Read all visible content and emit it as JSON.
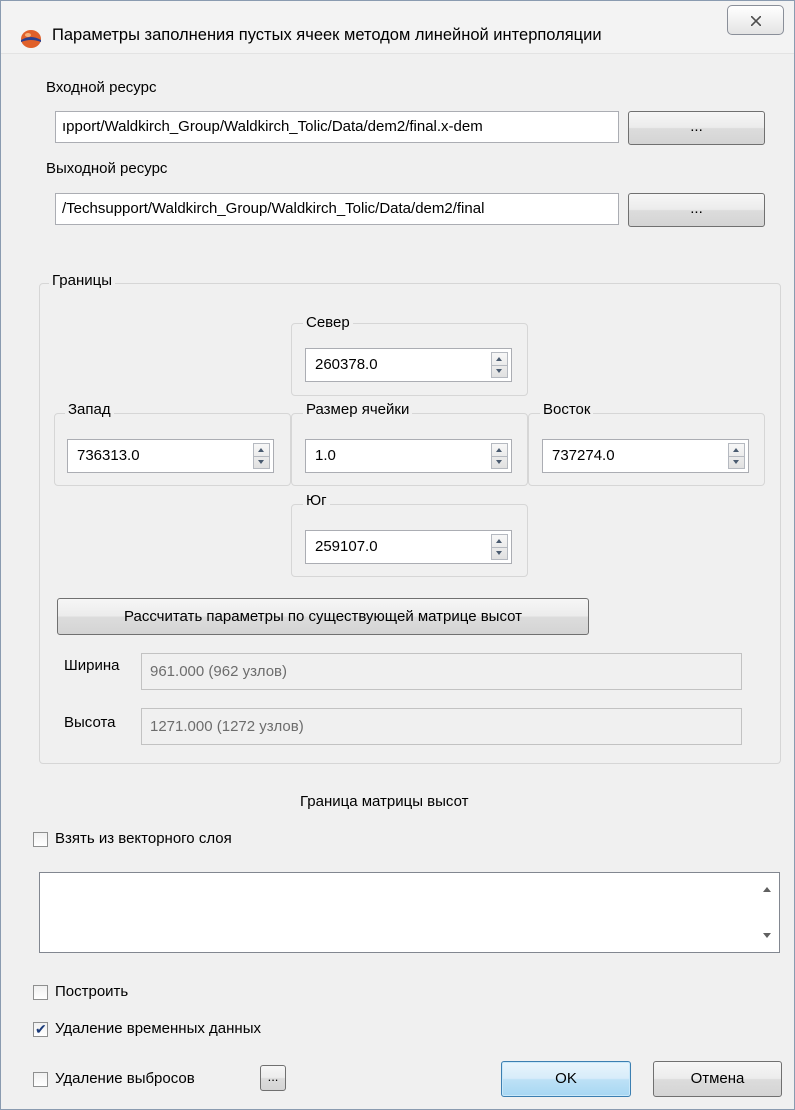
{
  "window": {
    "title": "Параметры заполнения пустых ячеек методом линейной интерполяции",
    "icon": "app-logo-icon",
    "close_icon": "close-icon"
  },
  "input_resource": {
    "label": "Входной ресурс",
    "value": "ıpport/Waldkirch_Group/Waldkirch_Tolic/Data/dem2/final.x-dem",
    "browse_label": "..."
  },
  "output_resource": {
    "label": "Выходной ресурс",
    "value": "/Techsupport/Waldkirch_Group/Waldkirch_Tolic/Data/dem2/final",
    "browse_label": "..."
  },
  "bounds": {
    "title": "Границы",
    "north": {
      "label": "Север",
      "value": "260378.0"
    },
    "west": {
      "label": "Запад",
      "value": "736313.0"
    },
    "cell_size": {
      "label": "Размер ячейки",
      "value": "1.0"
    },
    "east": {
      "label": "Восток",
      "value": "737274.0"
    },
    "south": {
      "label": "Юг",
      "value": "259107.0"
    },
    "calc_button": "Рассчитать параметры по существующей матрице высот",
    "width": {
      "label": "Ширина",
      "value": "961.000 (962 узлов)"
    },
    "height": {
      "label": "Высота",
      "value": "1271.000 (1272 узлов)"
    }
  },
  "dem_border": {
    "title": "Граница матрицы высот",
    "from_vector_label": "Взять из векторного слоя",
    "from_vector_checked": false
  },
  "options": {
    "build_label": "Построить",
    "build_checked": false,
    "delete_temp_label": "Удаление временных данных",
    "delete_temp_checked": true,
    "delete_outliers_label": "Удаление выбросов",
    "delete_outliers_checked": false,
    "outliers_settings_label": "..."
  },
  "buttons": {
    "ok": "OK",
    "cancel": "Отмена"
  }
}
